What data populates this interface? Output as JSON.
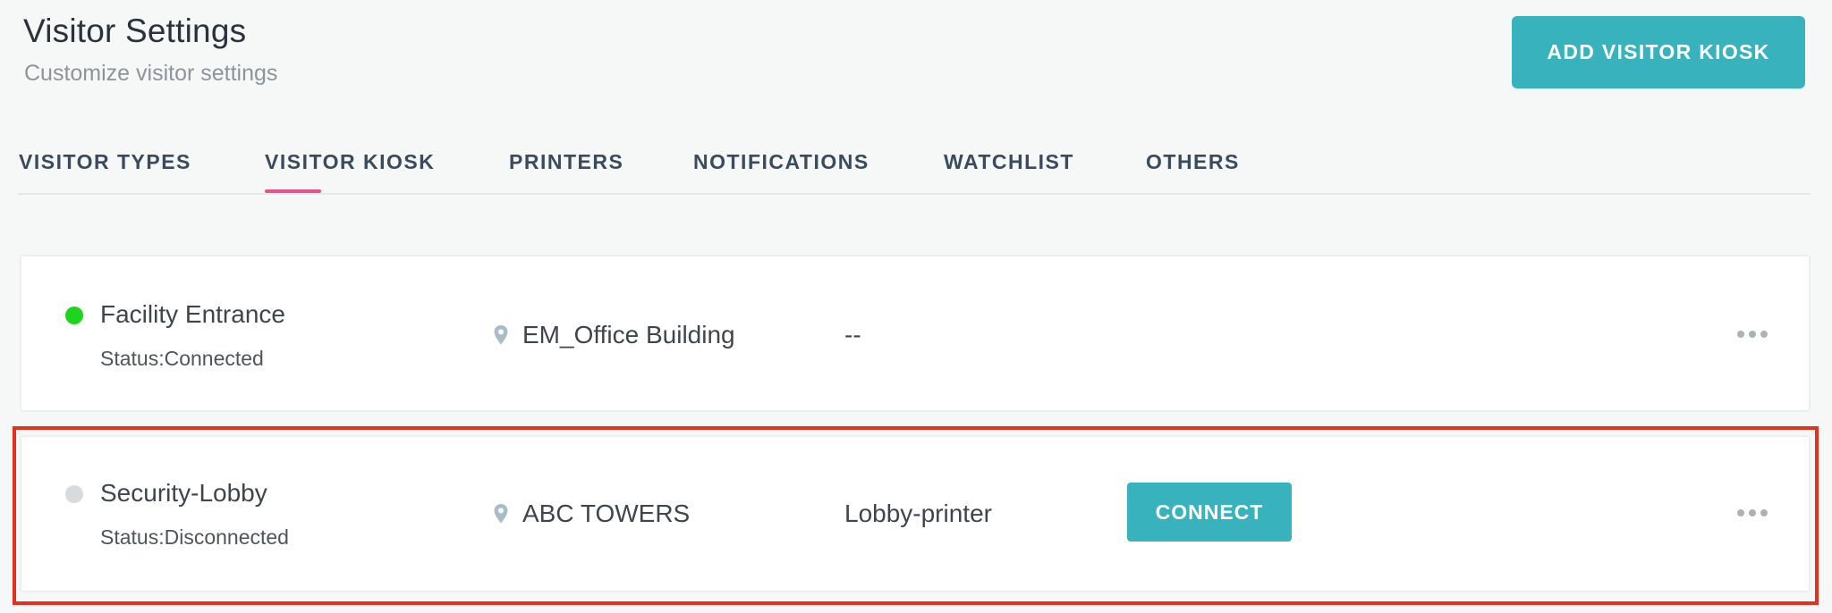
{
  "header": {
    "title": "Visitor Settings",
    "subtitle": "Customize visitor settings",
    "add_button_label": "ADD VISITOR KIOSK"
  },
  "tabs": [
    {
      "label": "VISITOR TYPES",
      "active": false
    },
    {
      "label": "VISITOR KIOSK",
      "active": true
    },
    {
      "label": "PRINTERS",
      "active": false
    },
    {
      "label": "NOTIFICATIONS",
      "active": false
    },
    {
      "label": "WATCHLIST",
      "active": false
    },
    {
      "label": "OTHERS",
      "active": false
    }
  ],
  "kiosks": [
    {
      "name": "Facility Entrance",
      "status": "Status:Connected",
      "status_color": "#1ed51e",
      "location": "EM_Office Building",
      "printer": "--"
    },
    {
      "name": "Security-Lobby",
      "status": "Status:Disconnected",
      "status_color": "#d8dbdd",
      "location": "ABC TOWERS",
      "printer": "Lobby-printer",
      "connect_label": "CONNECT"
    }
  ],
  "icons": {
    "location": "map-pin-icon",
    "more": "more-horizontal-icon"
  },
  "colors": {
    "accent": "#38b3be",
    "tab_underline": "#e3558d",
    "highlight_border": "#e5301f"
  }
}
